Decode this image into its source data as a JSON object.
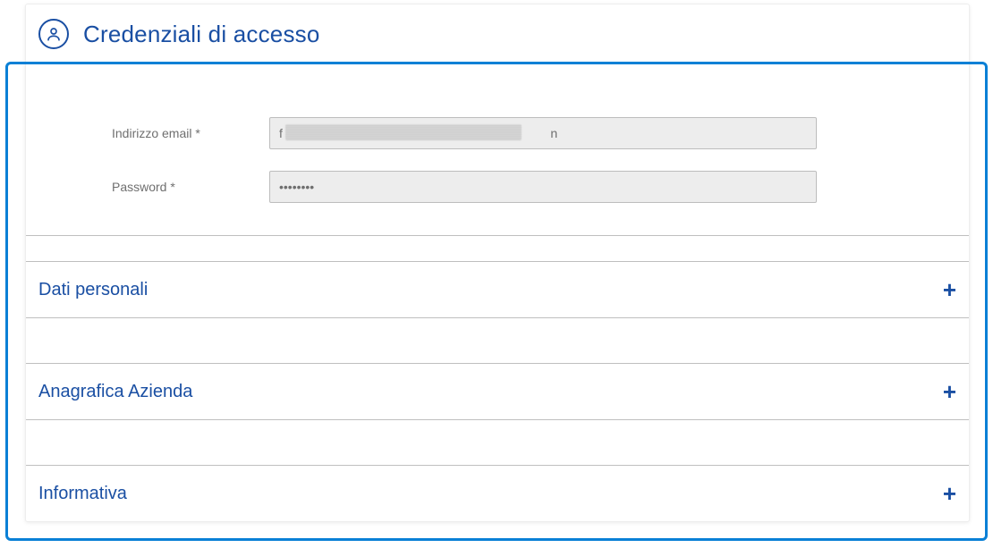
{
  "header": {
    "title": "Credenziali di accesso",
    "icon": "user-icon"
  },
  "form": {
    "email": {
      "label": "Indirizzo email *",
      "value": "f                                                                             n"
    },
    "password": {
      "label": "Password *",
      "value": "••••••••"
    }
  },
  "accordions": [
    {
      "title": "Dati personali",
      "expand_icon": "+"
    },
    {
      "title": "Anagrafica Azienda",
      "expand_icon": "+"
    },
    {
      "title": "Informativa",
      "expand_icon": "+"
    }
  ]
}
